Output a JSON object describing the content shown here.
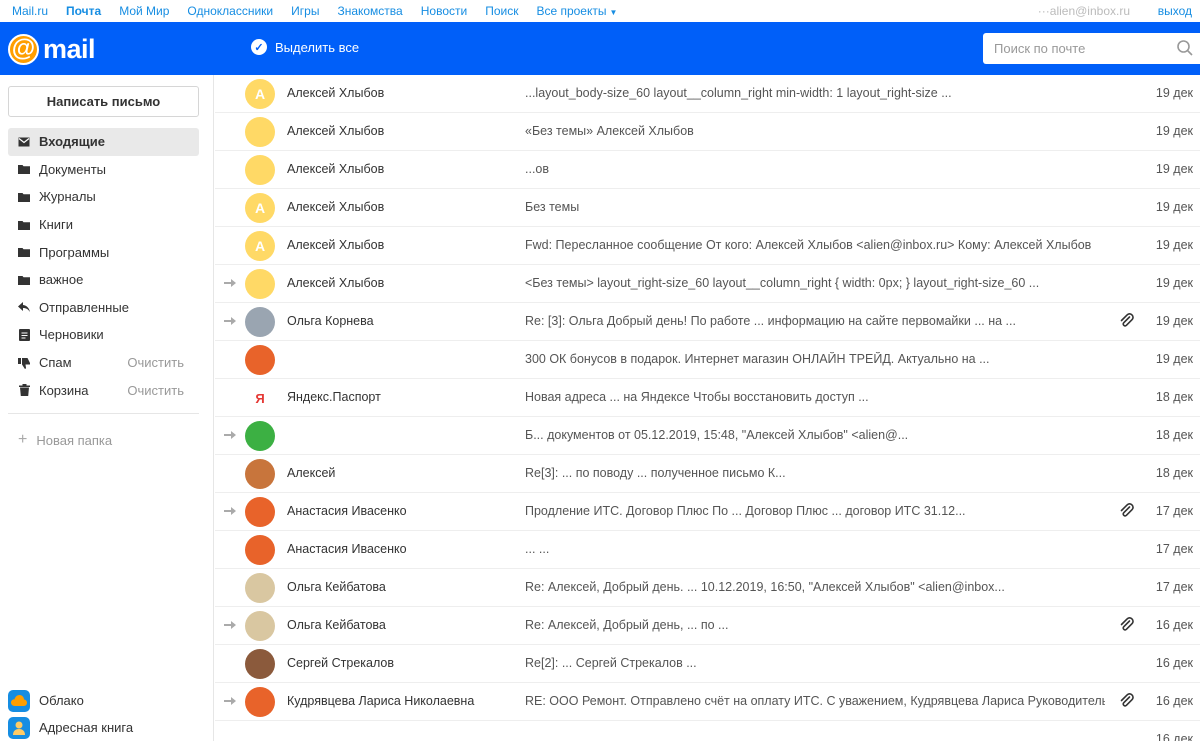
{
  "portal": {
    "links": [
      "Mail.ru",
      "Почта",
      "Мой Мир",
      "Одноклассники",
      "Игры",
      "Знакомства",
      "Новости",
      "Поиск",
      "Все проекты"
    ],
    "active_link": "Почта",
    "user_email": "···alien@inbox.ru",
    "exit_label": "выход"
  },
  "header": {
    "logo_text": "mail",
    "select_all_label": "Выделить все",
    "search_placeholder": "Поиск по почте",
    "brand_color": "#005ff9"
  },
  "sidebar": {
    "compose_label": "Написать письмо",
    "folders": [
      {
        "label": "Входящие",
        "icon": "inbox-icon",
        "active": true
      },
      {
        "label": "Документы",
        "icon": "folder-icon"
      },
      {
        "label": "Журналы",
        "icon": "folder-icon"
      },
      {
        "label": "Книги",
        "icon": "folder-icon"
      },
      {
        "label": "Программы",
        "icon": "folder-icon"
      },
      {
        "label": "важное",
        "icon": "folder-icon"
      },
      {
        "label": "Отправленные",
        "icon": "reply-icon"
      },
      {
        "label": "Черновики",
        "icon": "draft-icon"
      },
      {
        "label": "Спам",
        "icon": "thumbs-down-icon",
        "action": "Очистить"
      },
      {
        "label": "Корзина",
        "icon": "trash-icon",
        "action": "Очистить"
      }
    ],
    "new_folder_label": "Новая папка",
    "apps": [
      {
        "label": "Облако",
        "icon": "cloud-icon",
        "color": "#168de2"
      },
      {
        "label": "Адресная книга",
        "icon": "contacts-icon",
        "color": "#168de2"
      }
    ]
  },
  "messages": [
    {
      "sender": "Алексей Хлыбов",
      "subject": "...layout_body-size_60 layout__column_right min-width: 1 layout_right-size ...",
      "date": "19 дек",
      "avatar_color": "#ffd966",
      "avatar_letter": "А",
      "forwarded": false,
      "attachment": false
    },
    {
      "sender": "Алексей Хлыбов",
      "subject": "«Без темы» Алексей Хлыбов",
      "date": "19 дек",
      "avatar_color": "#ffd966",
      "avatar_letter": "",
      "forwarded": false,
      "attachment": false
    },
    {
      "sender": "Алексей Хлыбов",
      "subject": "...ов",
      "date": "19 дек",
      "avatar_color": "#ffd966",
      "avatar_letter": "",
      "forwarded": false,
      "attachment": false
    },
    {
      "sender": "Алексей Хлыбов",
      "subject": "Без темы",
      "date": "19 дек",
      "avatar_color": "#ffd966",
      "avatar_letter": "А",
      "forwarded": false,
      "attachment": false
    },
    {
      "sender": "Алексей Хлыбов",
      "subject": "Fwd: Пересланное сообщение От кого: Алексей Хлыбов <alien@inbox.ru> Кому: Алексей Хлыбов",
      "date": "19 дек",
      "avatar_color": "#ffd966",
      "avatar_letter": "А",
      "forwarded": false,
      "attachment": false
    },
    {
      "sender": "Алексей Хлыбов",
      "subject": "<Без темы> layout_right-size_60 layout__column_right { width: 0px; } layout_right-size_60 ...",
      "date": "19 дек",
      "avatar_color": "#ffd966",
      "avatar_letter": "",
      "forwarded": true,
      "attachment": false
    },
    {
      "sender": "Ольга Корнева",
      "subject": "Re: [3]: Ольга Добрый день! По работе ... информацию на сайте первомайки ... на ...",
      "date": "19 дек",
      "avatar_color": "#9aa5b1",
      "avatar_letter": "",
      "forwarded": true,
      "attachment": true
    },
    {
      "sender": "",
      "subject": "300 ОК бонусов в подарок. Интернет магазин ОНЛАЙН ТРЕЙД. Актуально на ...",
      "date": "19 дек",
      "avatar_color": "#e8632a",
      "avatar_letter": "",
      "forwarded": false,
      "attachment": false
    },
    {
      "sender": "Яндекс.Паспорт",
      "subject": "Новая адреса ... на Яндексе Чтобы восстановить доступ ...",
      "date": "18 дек",
      "avatar_color": "#ffffff",
      "avatar_letter": "Я",
      "forwarded": false,
      "attachment": false
    },
    {
      "sender": "",
      "subject": "Б... документов от 05.12.2019, 15:48, \"Алексей Хлыбов\" <alien@...",
      "date": "18 дек",
      "avatar_color": "#3cb043",
      "avatar_letter": "",
      "forwarded": true,
      "attachment": false
    },
    {
      "sender": "Алексей",
      "subject": "Re[3]: ... по поводу ... полученное письмо К...",
      "date": "18 дек",
      "avatar_color": "#c8753c",
      "avatar_letter": "",
      "forwarded": false,
      "attachment": false
    },
    {
      "sender": "Анастасия Ивасенко",
      "subject": "Продление ИТС. Договор Плюс По ... Договор Плюс ... договор ИТС 31.12...",
      "date": "17 дек",
      "avatar_color": "#e8632a",
      "avatar_letter": "",
      "forwarded": true,
      "attachment": true
    },
    {
      "sender": "Анастасия Ивасенко",
      "subject": "... ...",
      "date": "17 дек",
      "avatar_color": "#e8632a",
      "avatar_letter": "",
      "forwarded": false,
      "attachment": false
    },
    {
      "sender": "Ольга Кейбатова",
      "subject": "Re: Алексей, Добрый день. ... 10.12.2019, 16:50, \"Алексей Хлыбов\" <alien@inbox...",
      "date": "17 дек",
      "avatar_color": "#d9c7a1",
      "avatar_letter": "",
      "forwarded": false,
      "attachment": false
    },
    {
      "sender": "Ольга Кейбатова",
      "subject": "Re: Алексей, Добрый день, ... по ...",
      "date": "16 дек",
      "avatar_color": "#d9c7a1",
      "avatar_letter": "",
      "forwarded": true,
      "attachment": true
    },
    {
      "sender": "Сергей Стрекалов",
      "subject": "Re[2]: ... Сергей Стрекалов ...",
      "date": "16 дек",
      "avatar_color": "#8b5a3c",
      "avatar_letter": "",
      "forwarded": false,
      "attachment": false
    },
    {
      "sender": "Кудрявцева Лариса Николаевна",
      "subject": "RE: ООО Ремонт. Отправлено счёт на оплату ИТС. С уважением, Кудрявцева Лариса Руководитель ...",
      "date": "16 дек",
      "avatar_color": "#e8632a",
      "avatar_letter": "",
      "forwarded": true,
      "attachment": true
    },
    {
      "sender": "",
      "subject": "... ...",
      "date": "16 дек",
      "avatar_color": "#ffffff",
      "avatar_letter": "",
      "forwarded": false,
      "attachment": false
    }
  ]
}
